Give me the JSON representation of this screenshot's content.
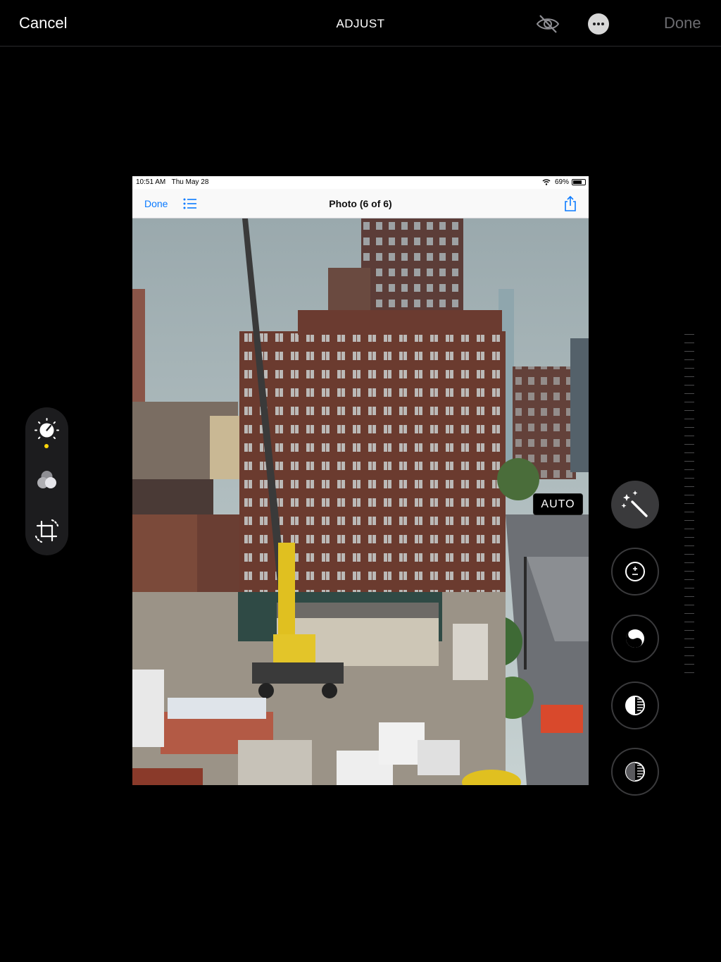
{
  "topbar": {
    "cancel_label": "Cancel",
    "title": "ADJUST",
    "done_label": "Done",
    "hide_icon": "eye-slash-icon",
    "more_icon": "ellipsis-circle-icon"
  },
  "tools": [
    {
      "name": "adjust",
      "icon": "adjust-dial-icon",
      "selected": true
    },
    {
      "name": "filters",
      "icon": "filters-icon",
      "selected": false
    },
    {
      "name": "crop",
      "icon": "crop-rotate-icon",
      "selected": false
    }
  ],
  "photo": {
    "status_time": "10:51 AM",
    "status_date": "Thu May 28",
    "battery": "69%",
    "nav_done": "Done",
    "nav_title": "Photo (6 of 6)"
  },
  "adjustments": {
    "auto_label": "AUTO",
    "items": [
      {
        "name": "auto",
        "icon": "magic-wand-icon",
        "active": true
      },
      {
        "name": "exposure",
        "icon": "exposure-icon"
      },
      {
        "name": "brilliance",
        "icon": "brilliance-icon"
      },
      {
        "name": "highlights",
        "icon": "highlights-icon"
      },
      {
        "name": "shadows",
        "icon": "shadows-icon"
      }
    ]
  },
  "colors": {
    "accent_yellow": "#ffd60a",
    "ios_blue": "#0a7aff",
    "done_disabled": "#6c6c70"
  }
}
